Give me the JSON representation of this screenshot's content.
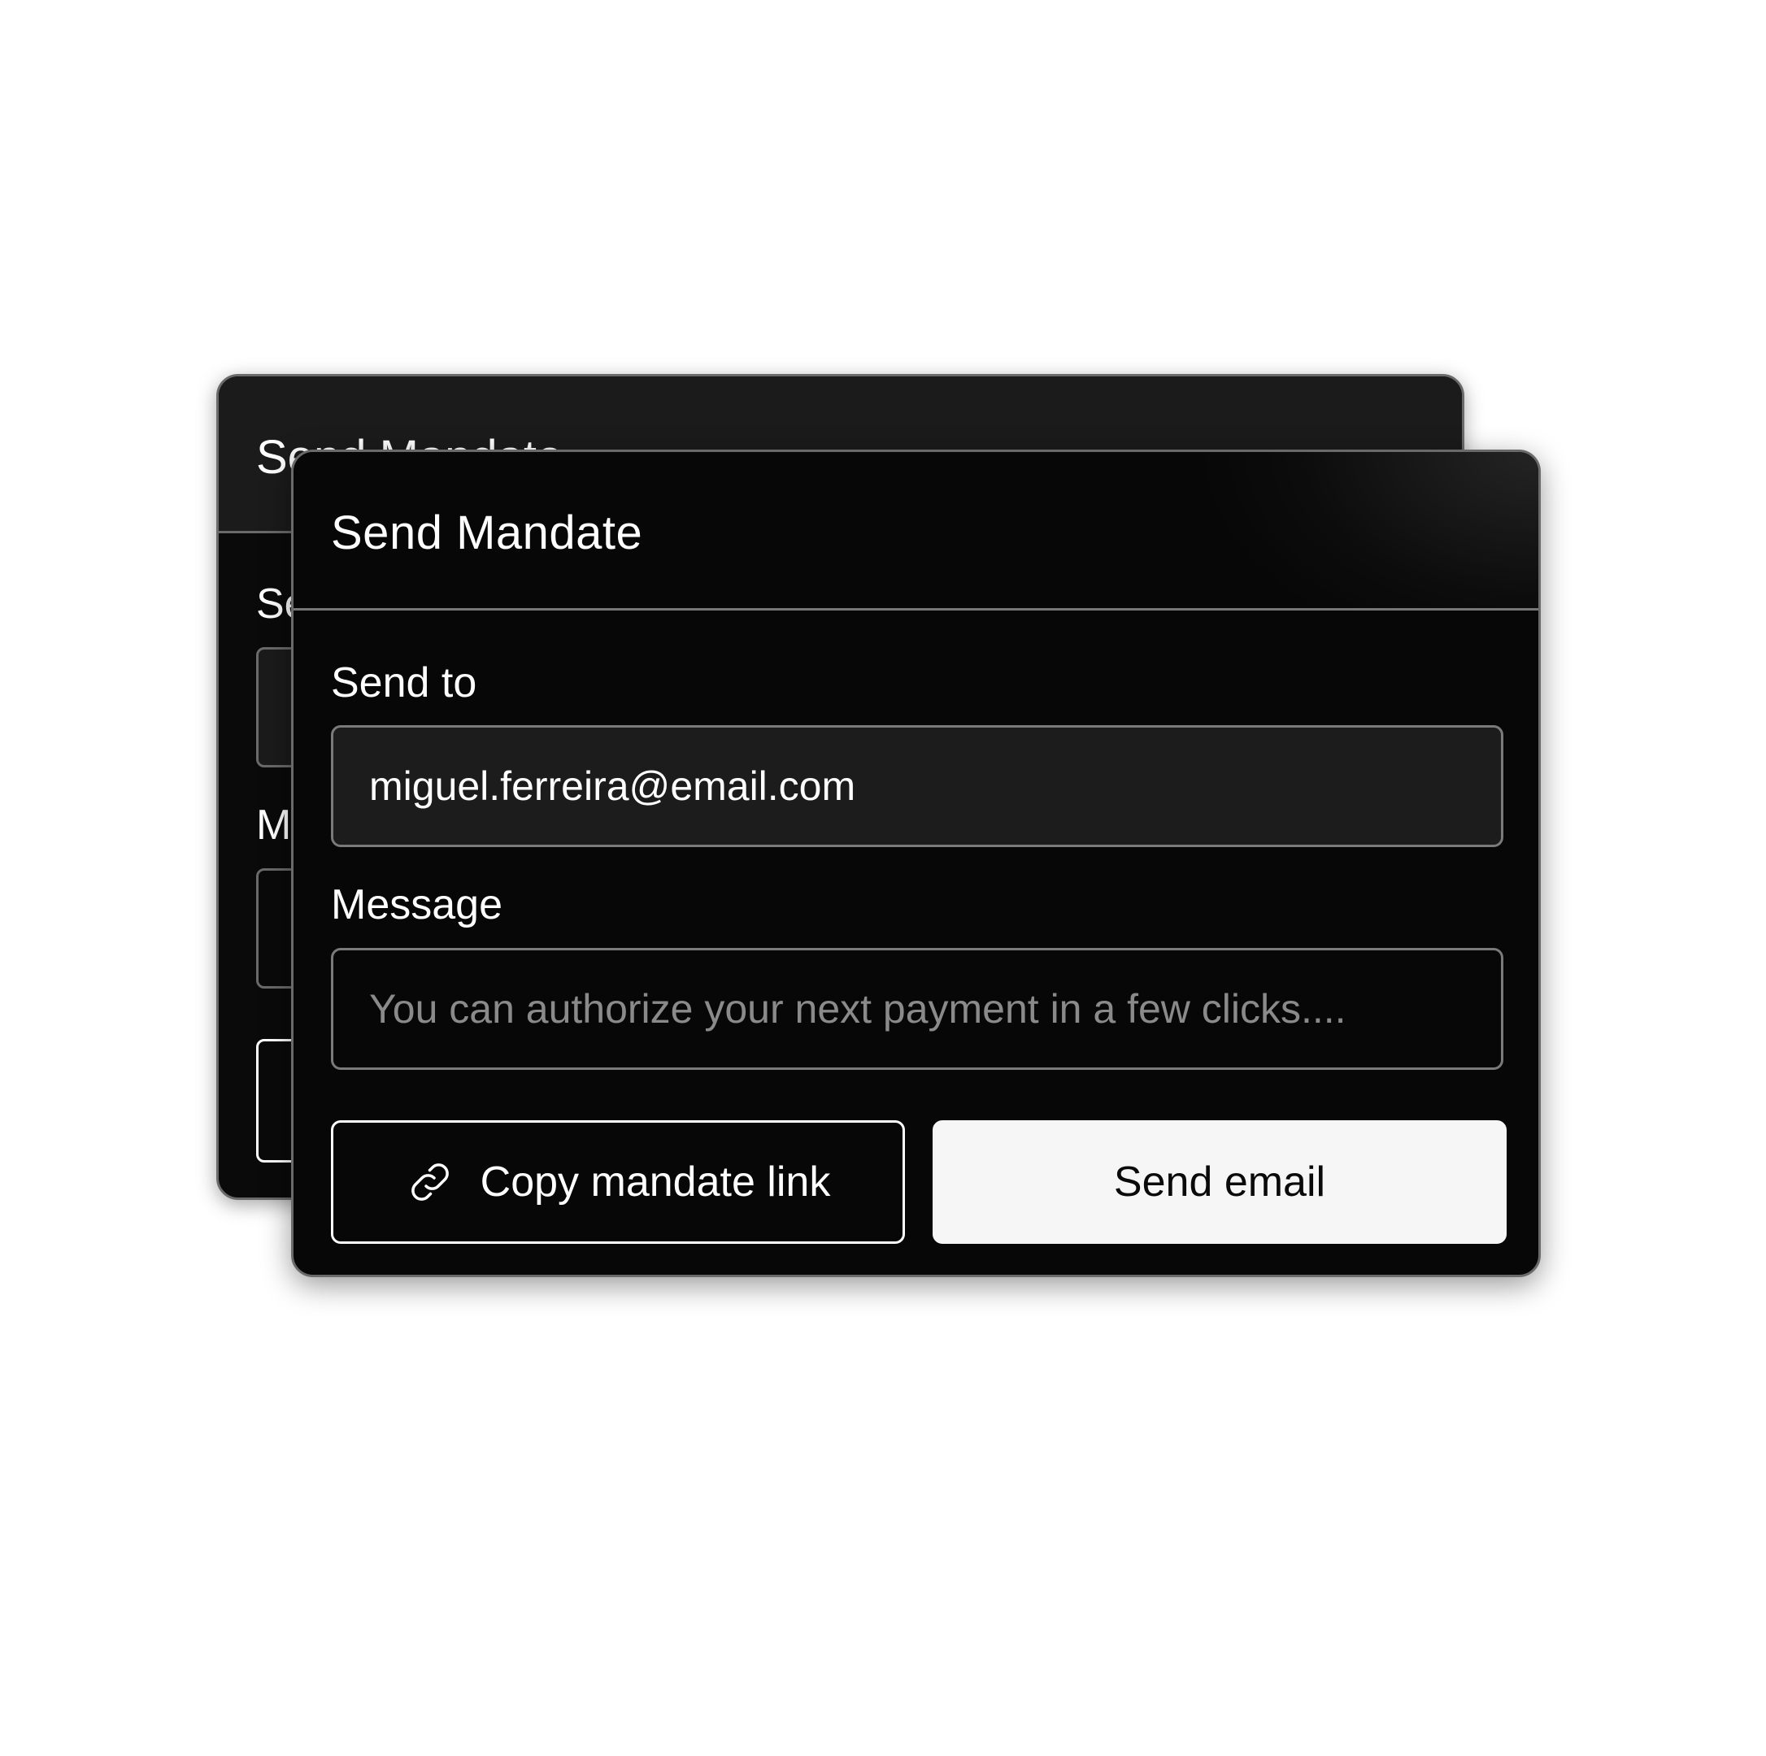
{
  "dialog": {
    "title": "Send Mandate",
    "send_to_label": "Send to",
    "send_to_value": "miguel.ferreira@email.com",
    "message_label": "Message",
    "message_placeholder": "You can authorize your next payment in a few clicks....",
    "copy_link_label": "Copy mandate link",
    "copy_link_icon": "link-icon",
    "send_email_label": "Send email"
  },
  "background_dialog": {
    "title": "Send Mandate",
    "send_to_label": "Send to",
    "message_label": "Message"
  },
  "colors": {
    "card_background": "#070707",
    "field_background": "#1c1c1c",
    "border": "#7a7a7a",
    "primary_button": "#f6f6f6",
    "text": "#ffffff",
    "placeholder": "#8a8a8a"
  }
}
